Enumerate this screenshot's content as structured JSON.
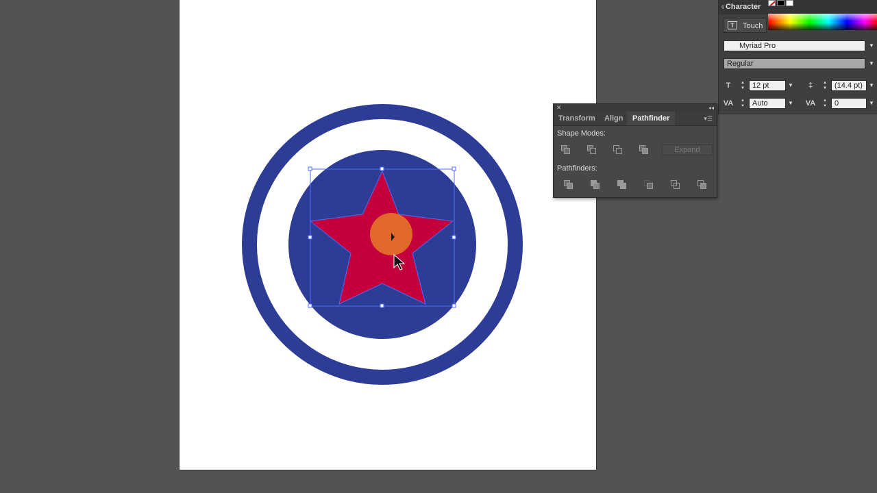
{
  "colors": {
    "outer_ring": "#2d3c94",
    "inner_disc": "#2d3c94",
    "star": "#c4003c",
    "center_circle": "#e0682a",
    "selection": "#4f6bff",
    "artboard": "#ffffff",
    "workspace": "#535353"
  },
  "character_panel": {
    "title": "Character",
    "touch_label": "Touch",
    "touch_icon": "touch-type-icon",
    "font_family": "Myriad Pro",
    "font_style": "Regular",
    "font_size": "12 pt",
    "leading": "(14.4 pt)",
    "kerning": "Auto",
    "tracking": "0"
  },
  "pathfinder_panel": {
    "tabs": [
      "Transform",
      "Align",
      "Pathfinder"
    ],
    "active_tab": "Pathfinder",
    "shape_modes_label": "Shape Modes:",
    "shape_modes": [
      "unite-icon",
      "minus-front-icon",
      "intersect-icon",
      "exclude-icon"
    ],
    "expand_label": "Expand",
    "pathfinders_label": "Pathfinders:",
    "pathfinders": [
      "divide-icon",
      "trim-icon",
      "merge-icon",
      "crop-icon",
      "outline-icon",
      "minus-back-icon"
    ]
  }
}
